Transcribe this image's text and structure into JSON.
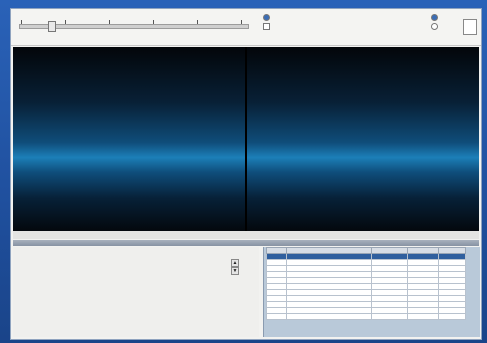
{
  "toolbar": {
    "slider_title": "",
    "slider_value_fraction": 0.13,
    "ticks": [
      "",
      "",
      "",
      "",
      "",
      ""
    ],
    "view_options": [
      {
        "label": "",
        "selected": true
      },
      {
        "label": "",
        "checked": true
      }
    ],
    "right_options": [
      {
        "label": "",
        "selected": true
      },
      {
        "label": "",
        "selected": false
      }
    ]
  },
  "viewer": {
    "left_caption": "",
    "right_caption": ""
  },
  "section_title": "",
  "details": {
    "fields": [
      {
        "label": "",
        "value": ""
      },
      {
        "label": "",
        "value": ""
      },
      {
        "label": "",
        "value": ""
      },
      {
        "label": "",
        "value": ""
      },
      {
        "label": "",
        "value": ""
      },
      {
        "label": "",
        "value": ""
      },
      {
        "label": "",
        "value": ""
      },
      {
        "label": "",
        "value": ""
      }
    ],
    "spin_up": "▲",
    "spin_down": "▼",
    "spin_value": "",
    "colors": {
      "label": "#555555",
      "value": "#222222"
    }
  },
  "table": {
    "columns": [
      "",
      "",
      "",
      "",
      ""
    ],
    "rows": [
      [
        "",
        "",
        "",
        "",
        ""
      ],
      [
        "",
        "",
        "",
        "",
        ""
      ],
      [
        "",
        "",
        "",
        "",
        ""
      ],
      [
        "",
        "",
        "",
        "",
        ""
      ],
      [
        "",
        "",
        "",
        "",
        ""
      ],
      [
        "",
        "",
        "",
        "",
        ""
      ],
      [
        "",
        "",
        "",
        "",
        ""
      ],
      [
        "",
        "",
        "",
        "",
        ""
      ],
      [
        "",
        "",
        "",
        "",
        ""
      ],
      [
        "",
        "",
        "",
        "",
        ""
      ],
      [
        "",
        "",
        "",
        "",
        ""
      ]
    ],
    "selected_row": 0,
    "colors": {
      "selected": "#2f5f9e",
      "header": "#d7dde5"
    }
  },
  "colors": {
    "desktop": "#2a62b8",
    "app_background": "#f2f2f0",
    "image_glow": "#1c7fb8"
  }
}
